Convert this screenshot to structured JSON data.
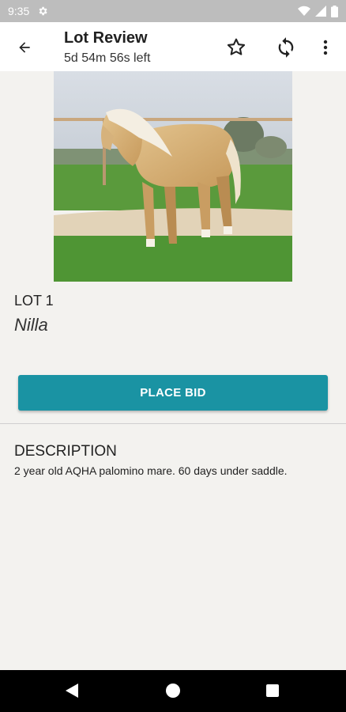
{
  "status_bar": {
    "time": "9:35"
  },
  "header": {
    "title": "Lot Review",
    "countdown": "5d 54m 56s left"
  },
  "lot": {
    "number_label": "LOT 1",
    "name": "Nilla"
  },
  "actions": {
    "place_bid_label": "PLACE BID"
  },
  "description": {
    "heading": "DESCRIPTION",
    "text": "2 year old AQHA palomino mare. 60 days under saddle."
  },
  "colors": {
    "accent": "#1a93a3",
    "status_bar": "#bdbdbd",
    "background": "#f3f2ef"
  },
  "icons": [
    "settings-icon",
    "wifi-icon",
    "signal-icon",
    "battery-icon",
    "back-arrow-icon",
    "star-outline-icon",
    "refresh-icon",
    "more-vert-icon",
    "nav-back-icon",
    "nav-home-icon",
    "nav-recents-icon"
  ]
}
